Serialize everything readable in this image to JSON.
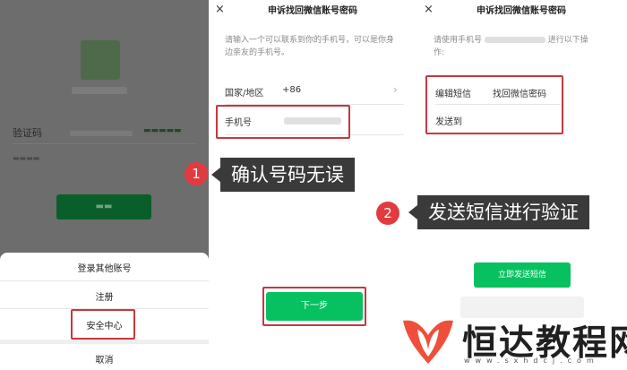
{
  "panel1": {
    "code_label": "验证码",
    "sheet": {
      "other_account": "登录其他账号",
      "register": "注册",
      "security_center": "安全中心",
      "cancel": "取消"
    }
  },
  "panel2": {
    "close_glyph": "×",
    "title": "申诉找回微信账号密码",
    "instruction_1": "请输入一个可以联系到你的手机号，可以是你身",
    "instruction_2": "边亲友的手机号。",
    "country_label": "国家/地区",
    "country_value": "+86",
    "phone_label": "手机号",
    "next_button": "下一步"
  },
  "panel3": {
    "close_glyph": "×",
    "title": "申诉找回微信账号密码",
    "instruction_prefix": "请使用手机号",
    "instruction_suffix": "进行以下操",
    "instruction_line2": "作:",
    "edit_sms_label": "编辑短信",
    "edit_sms_value": "找回微信密码",
    "send_to_label": "发送到",
    "send_button": "立即发送短信"
  },
  "annotations": {
    "step1_number": "1",
    "step1_text": "确认号码无误",
    "step2_number": "2",
    "step2_text": "发送短信进行验证"
  },
  "watermark": {
    "name": "恒达教程网",
    "url": "www.sxhdcj.com"
  },
  "colors": {
    "wechat_green": "#07c160",
    "highlight_red": "#c6383f",
    "badge_red": "#e23b3f",
    "callout_bg": "#3a3a3a"
  }
}
